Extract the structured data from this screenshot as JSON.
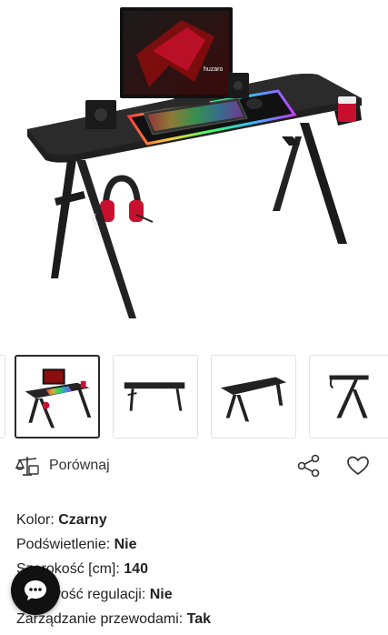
{
  "hero": {
    "image_alt_icon": "gaming-desk-image",
    "monitor_brand": "huzaro",
    "leg_brand": "huzaro"
  },
  "thumbnails": [
    {
      "icon": "desk-with-setup",
      "active": true
    },
    {
      "icon": "desk-front-view",
      "active": false
    },
    {
      "icon": "desk-angle-view",
      "active": false
    },
    {
      "icon": "desk-side-view",
      "active": false
    }
  ],
  "actions": {
    "compare_label": "Porównaj",
    "compare_icon": "scale-icon",
    "share_icon": "share-icon",
    "favorite_icon": "heart-icon"
  },
  "specs": [
    {
      "label": "Kolor:",
      "value": "Czarny"
    },
    {
      "label": "Podświetlenie:",
      "value": "Nie"
    },
    {
      "label": "Szerokość [cm]:",
      "value": "140"
    },
    {
      "label": "Możliwość regulacji:",
      "value": "Nie"
    },
    {
      "label": "Zarządzanie przewodami:",
      "value": "Tak"
    }
  ],
  "chat": {
    "icon": "chat-bubble-icon"
  },
  "colors": {
    "accent": "#111111",
    "rgb_red": "#c8102e"
  }
}
